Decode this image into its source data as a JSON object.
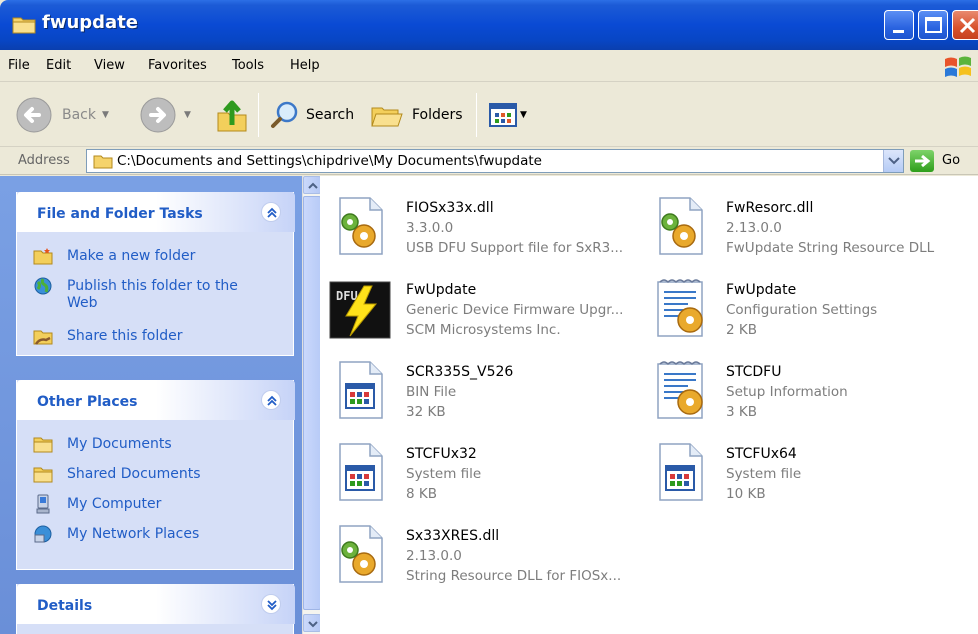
{
  "window": {
    "title": "fwupdate"
  },
  "menu": [
    "File",
    "Edit",
    "View",
    "Favorites",
    "Tools",
    "Help"
  ],
  "toolbar": {
    "back_label": "Back",
    "search_label": "Search",
    "folders_label": "Folders"
  },
  "address": {
    "label": "Address",
    "value": "C:\\Documents and Settings\\chipdrive\\My Documents\\fwupdate",
    "go_label": "Go"
  },
  "tasks_panel": {
    "title": "File and Folder Tasks",
    "items": [
      {
        "label": "Make a new folder",
        "icon": "new-folder-icon"
      },
      {
        "label": "Publish this folder to the Web",
        "icon": "publish-web-icon"
      },
      {
        "label": "Share this folder",
        "icon": "share-folder-icon"
      }
    ]
  },
  "places_panel": {
    "title": "Other Places",
    "items": [
      {
        "label": "My Documents",
        "icon": "folder-icon"
      },
      {
        "label": "Shared Documents",
        "icon": "folder-icon"
      },
      {
        "label": "My Computer",
        "icon": "computer-icon"
      },
      {
        "label": "My Network Places",
        "icon": "network-icon"
      }
    ]
  },
  "details_panel": {
    "title": "Details"
  },
  "files": [
    {
      "name": "FIOSx33x.dll",
      "line1": "3.3.0.0",
      "line2": "USB DFU Support file for SxR3...",
      "icon": "dll-icon"
    },
    {
      "name": "FwResorc.dll",
      "line1": "2.13.0.0",
      "line2": "FwUpdate String Resource DLL",
      "icon": "dll-icon"
    },
    {
      "name": "FwUpdate",
      "line1": "Generic Device Firmware Upgr...",
      "line2": "SCM Microsystems Inc.",
      "icon": "dfu-app-icon"
    },
    {
      "name": "FwUpdate",
      "line1": "Configuration Settings",
      "line2": "2 KB",
      "icon": "config-settings-icon"
    },
    {
      "name": "SCR335S_V526",
      "line1": "BIN File",
      "line2": "32 KB",
      "icon": "bin-file-icon"
    },
    {
      "name": "STCDFU",
      "line1": "Setup Information",
      "line2": "3 KB",
      "icon": "setup-info-icon"
    },
    {
      "name": "STCFUx32",
      "line1": "System file",
      "line2": "8 KB",
      "icon": "system-file-icon"
    },
    {
      "name": "STCFUx64",
      "line1": "System file",
      "line2": "10 KB",
      "icon": "system-file-icon"
    },
    {
      "name": "Sx33XRES.dll",
      "line1": "2.13.0.0",
      "line2": "String Resource DLL for FIOSx...",
      "icon": "dll-icon"
    }
  ]
}
